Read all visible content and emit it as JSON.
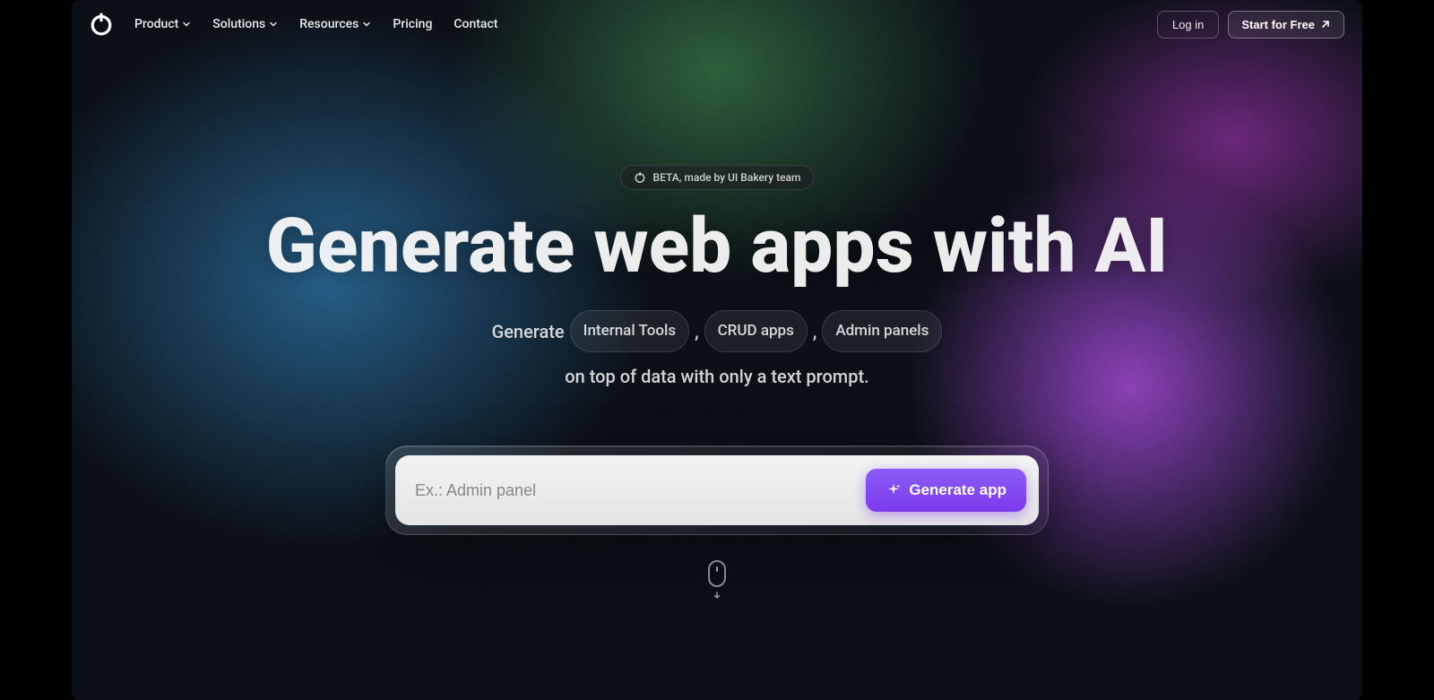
{
  "navbar": {
    "links": [
      "Product",
      "Solutions",
      "Resources",
      "Pricing",
      "Contact"
    ],
    "login_label": "Log in",
    "cta_label": "Start for Free"
  },
  "beta_pill": "BETA, made by UI Bakery team",
  "headline": "Generate web apps with AI",
  "subline": {
    "lead": "Generate",
    "chip1": "Internal Tools",
    "comma1": ",",
    "chip2": "CRUD apps",
    "comma2": ",",
    "chip3": "Admin panels",
    "trail": "on top of data with only a text prompt."
  },
  "prompt": {
    "placeholder": "Ex.: Admin panel",
    "button": "Generate app"
  },
  "colors": {
    "accent": "#7c3aed"
  }
}
